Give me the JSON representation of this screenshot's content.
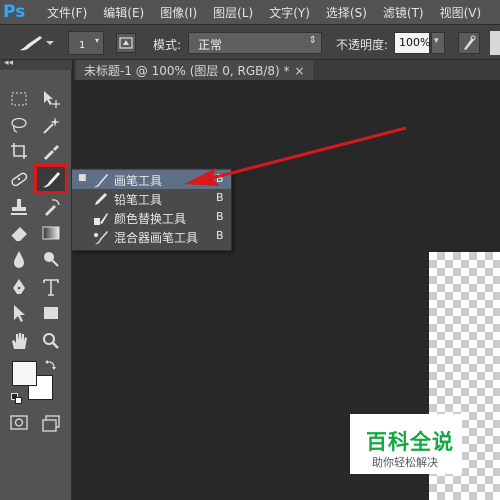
{
  "app": {
    "logo_text": "Ps"
  },
  "menubar": {
    "items": [
      {
        "label": "文件(F)"
      },
      {
        "label": "编辑(E)"
      },
      {
        "label": "图像(I)"
      },
      {
        "label": "图层(L)"
      },
      {
        "label": "文字(Y)"
      },
      {
        "label": "选择(S)"
      },
      {
        "label": "滤镜(T)"
      },
      {
        "label": "视图(V)"
      }
    ]
  },
  "options_bar": {
    "brush_size": "1",
    "mode_label": "模式:",
    "mode_value": "正常",
    "opacity_label": "不透明度:",
    "opacity_value": "100%"
  },
  "document": {
    "tab_title": "未标题-1 @ 100% (图层 0, RGB/8) *",
    "close_glyph": "×"
  },
  "flyout_menu": {
    "items": [
      {
        "label": "画笔工具",
        "shortcut": "B",
        "selected": true,
        "icon": "brush-icon"
      },
      {
        "label": "铅笔工具",
        "shortcut": "B",
        "selected": false,
        "icon": "pencil-icon"
      },
      {
        "label": "颜色替换工具",
        "shortcut": "B",
        "selected": false,
        "icon": "color-replacement-icon"
      },
      {
        "label": "混合器画笔工具",
        "shortcut": "B",
        "selected": false,
        "icon": "mixer-brush-icon"
      }
    ]
  },
  "toolbar": {
    "foreground_color": "#f6f6f6",
    "background_color": "#ffffff",
    "highlight_color": "#e0161b"
  },
  "annotation": {
    "arrow_color": "#d8191c"
  },
  "watermark": {
    "title": "百科全说",
    "subtitle": "助你轻松解决"
  }
}
